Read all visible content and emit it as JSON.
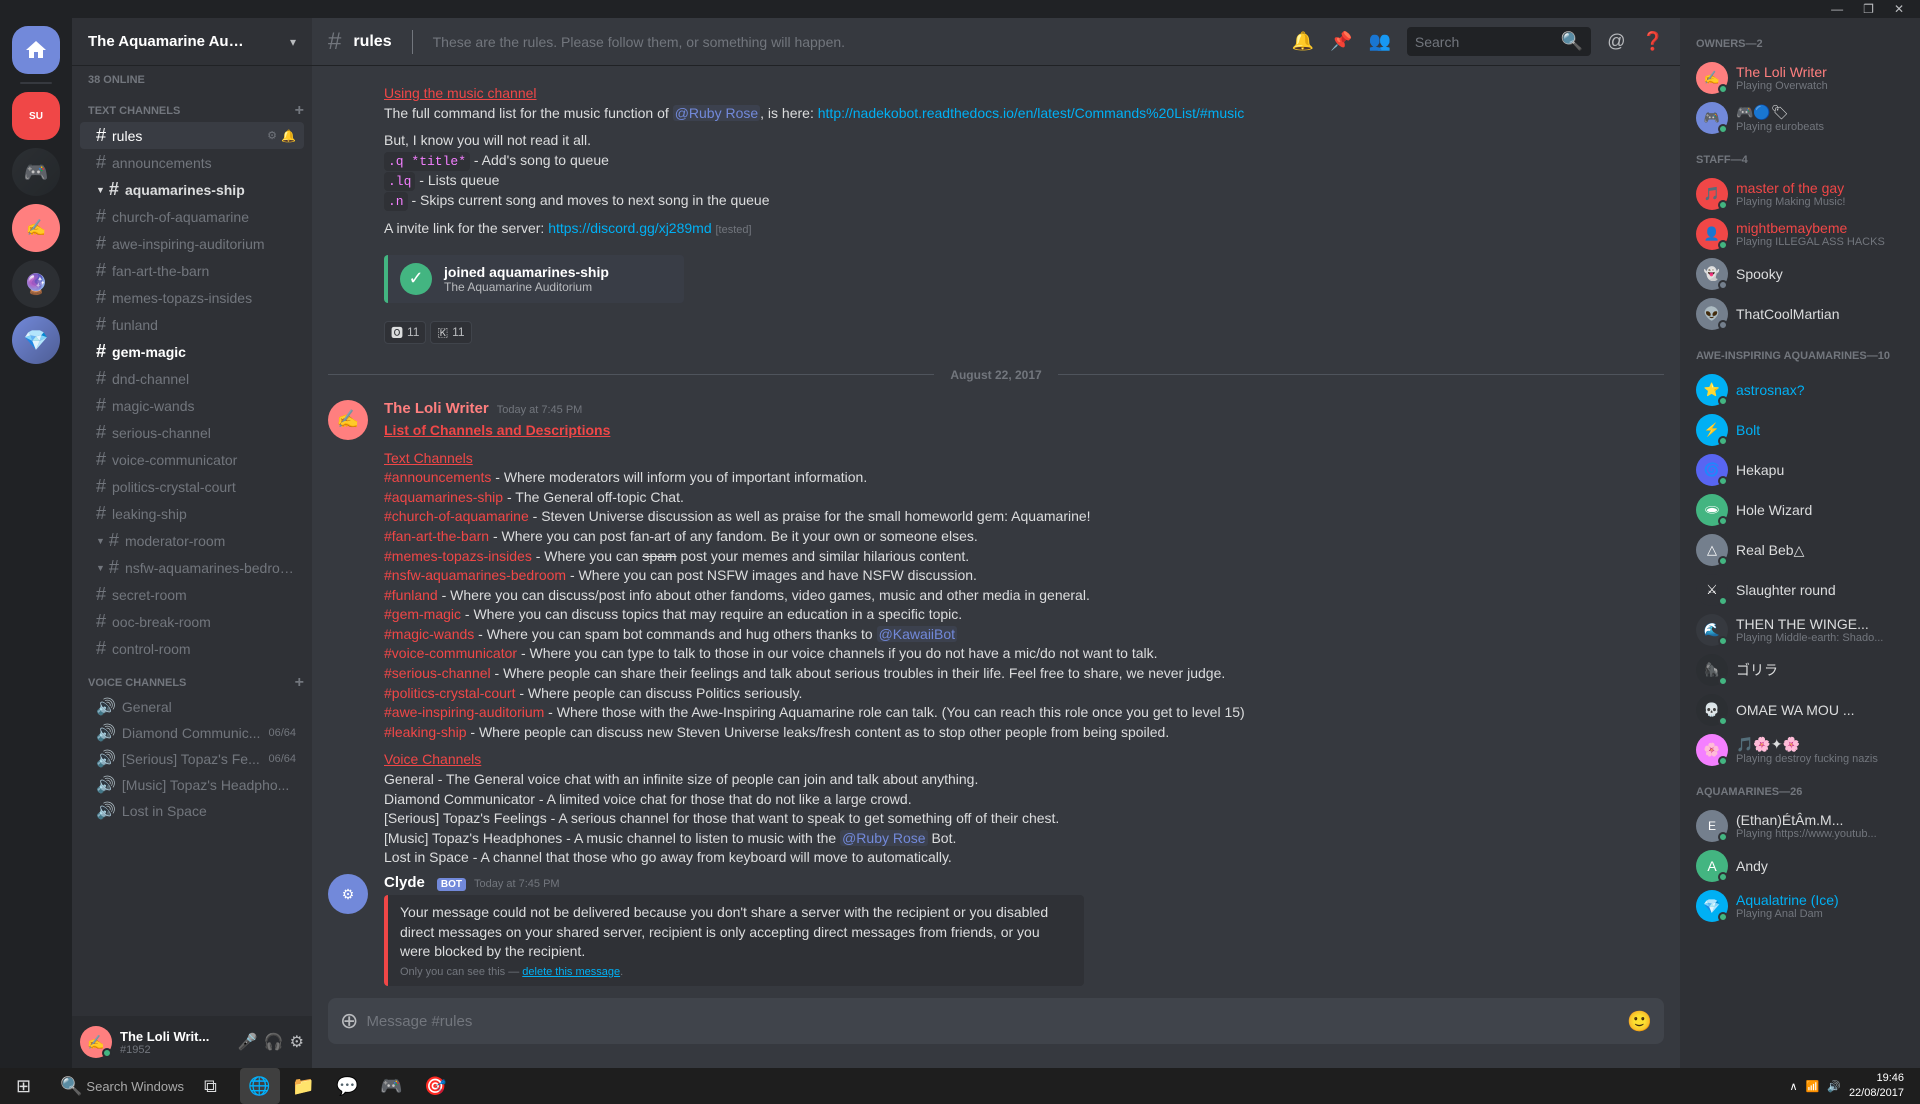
{
  "topbar": {
    "buttons": [
      "—",
      "❐",
      "✕"
    ]
  },
  "server": {
    "name": "The Aquamarine Auditori...",
    "online_count": "38 ONLINE"
  },
  "channel_header": {
    "name": "rules",
    "topic": "These are the rules. Please follow them, or something will happen.",
    "search_placeholder": "Search"
  },
  "sidebar": {
    "text_section_label": "TEXT CHANNELS",
    "voice_section_label": "VOICE CHANNELS",
    "text_channels": [
      {
        "name": "rules",
        "active": true,
        "unread": false
      },
      {
        "name": "announcements",
        "active": false,
        "unread": false
      },
      {
        "name": "aquamarines-ship",
        "active": false,
        "unread": true,
        "expandable": true
      },
      {
        "name": "church-of-aquamarine",
        "active": false,
        "unread": false
      },
      {
        "name": "awe-inspiring-auditorium",
        "active": false,
        "unread": false
      },
      {
        "name": "fan-art-the-barn",
        "active": false,
        "unread": false
      },
      {
        "name": "memes-topazs-insides",
        "active": false,
        "unread": false
      },
      {
        "name": "funland",
        "active": false,
        "unread": false
      },
      {
        "name": "gem-magic",
        "active": false,
        "unread": false,
        "bold": true
      },
      {
        "name": "dnd-channel",
        "active": false,
        "unread": false
      },
      {
        "name": "magic-wands",
        "active": false,
        "unread": false
      },
      {
        "name": "serious-channel",
        "active": false,
        "unread": false
      },
      {
        "name": "voice-communicator",
        "active": false,
        "unread": false
      },
      {
        "name": "politics-crystal-court",
        "active": false,
        "unread": false
      },
      {
        "name": "leaking-ship",
        "active": false,
        "unread": false
      },
      {
        "name": "moderator-room",
        "active": false,
        "unread": false,
        "expandable": true
      },
      {
        "name": "nsfw-aquamarines-bedroo...",
        "active": false,
        "unread": false,
        "expandable": true
      },
      {
        "name": "secret-room",
        "active": false,
        "unread": false
      },
      {
        "name": "ooc-break-room",
        "active": false,
        "unread": false
      },
      {
        "name": "control-room",
        "active": false,
        "unread": false
      }
    ],
    "voice_channels": [
      {
        "name": "General"
      },
      {
        "name": "Diamond Communic...",
        "count": "06/64"
      },
      {
        "name": "[Serious] Topaz's Fe...",
        "count": "06/64"
      },
      {
        "name": "[Music] Topaz's Headpho...",
        "count": ""
      },
      {
        "name": "Lost in Space",
        "count": ""
      }
    ]
  },
  "user_area": {
    "name": "The Loli Writ...",
    "discriminator": "#1952",
    "avatar_emoji": "✍"
  },
  "messages": [
    {
      "id": "msg1",
      "type": "system_top",
      "content_lines": [
        "Using the music channel",
        "The full command list for the music function of @Ruby Rose, is here: http://nadekobot.readthedocs.io/en/latest/Commands%20List/#music",
        "",
        "But, I know you will not read it all.",
        ".q *title* - Add's song to queue",
        ".lq - Lists queue",
        ".n - Skips current song and moves to next song in the queue",
        "",
        "A invite link for the server: https://discord.gg/xj289md [tested]"
      ]
    },
    {
      "id": "msg_reactions",
      "reactions": [
        {
          "emoji": "🅾",
          "count": "11"
        },
        {
          "emoji": "🇰",
          "count": "11"
        }
      ]
    },
    {
      "id": "date_divider",
      "date": "August 22, 2017"
    },
    {
      "id": "msg2",
      "author": "The Loli Writer",
      "author_color": "#ff7f7f",
      "timestamp": "Today at 7:45 PM",
      "content_title": "List of Channels and Descriptions",
      "content": [
        "Text Channels",
        "#announcements - Where moderators will inform you of important information.",
        "#aquamarines-ship - The General off-topic Chat.",
        "#church-of-aquamarine - Steven Universe discussion as well as praise for the small homeworld gem: Aquamarine!",
        "#fan-art-the-barn - Where you can post fan-art of any fandom. Be it your own or someone elses.",
        "#memes-topazs-insides - Where you can spam post your memes and similar hilarious content.",
        "#nsfw-aquamarines-bedroom - Where you can post NSFW images and have NSFW discussion.",
        "#funland - Where you can discuss/post info about other fandoms, video games, music and other media in general.",
        "#gem-magic - Where you can discuss topics that may require an education in a specific topic.",
        "#magic-wands - Where you can spam bot commands and hug others thanks to @KawaiiBot",
        "#voice-communicator - Where you can type to talk to those in our voice channels if you do not have a mic/do not want to talk.",
        "#serious-channel - Where people can share their feelings and talk about serious troubles in their life. Feel free to share, we never judge.",
        "#politics-crystal-court - Where people can discuss Politics seriously.",
        "#awe-inspiring-auditorium - Where those with the Awe-Inspiring Aquamarine role can talk. (You can reach this role once you get to level 15)",
        "#leaking-ship - Where people can discuss new Steven Universe leaks/fresh content as to stop other people from being spoiled.",
        "",
        "Voice Channels",
        "General - The General voice chat with an infinite size of people can join and talk about anything.",
        "Diamond Communicator - A limited voice chat for those that do not like a large crowd.",
        "[Serious] Topaz's Feelings - A serious channel for those that want to speak to get something off of their chest.",
        "[Music] Topaz's Headphones - A music channel to listen to music with the @Ruby Rose Bot.",
        "Lost in Space - A channel that those who go away from keyboard will move to automatically."
      ]
    },
    {
      "id": "msg3",
      "author": "Clyde",
      "author_color": "#7289da",
      "is_bot": true,
      "timestamp": "Today at 7:45 PM",
      "content": "Your message could not be delivered because you don't share a server with the recipient or you disabled direct messages on your shared server, recipient is only accepting direct messages from friends, or you were blocked by the recipient.",
      "only_you": "Only you can see this — delete this message."
    }
  ],
  "message_input": {
    "placeholder": "Message #rules"
  },
  "members": {
    "owners": {
      "label": "OWNERS—2",
      "items": [
        {
          "name": "The Loli Writer",
          "color": "#ff7f7f",
          "activity": "Playing Overwatch",
          "status": "online",
          "emoji": "✍"
        },
        {
          "name": "🎮🔵🏷",
          "color": "#dcddde",
          "activity": "Playing eurobeats",
          "status": "online",
          "emoji": "🎮"
        }
      ]
    },
    "staff": {
      "label": "STAFF—4",
      "items": [
        {
          "name": "master of the gay",
          "color": "#f04747",
          "activity": "Playing Making Music!",
          "status": "online",
          "emoji": "🎵"
        },
        {
          "name": "mightbemaybeme",
          "color": "#f04747",
          "activity": "Playing ILLEGAL ASS HACKS",
          "status": "online",
          "emoji": "👤"
        },
        {
          "name": "Spooky",
          "color": "#dcddde",
          "activity": "",
          "status": "offline",
          "emoji": "👻"
        },
        {
          "name": "ThatCoolMartian",
          "color": "#dcddde",
          "activity": "",
          "status": "offline",
          "emoji": "👽"
        }
      ]
    },
    "awe_inspiring": {
      "label": "AWE-INSPIRING AQUAMARINES—10",
      "items": [
        {
          "name": "astrosnax?",
          "color": "#00b0f4",
          "activity": "",
          "status": "online",
          "emoji": "⭐"
        },
        {
          "name": "Bolt",
          "color": "#00b0f4",
          "activity": "",
          "status": "online",
          "emoji": "⚡"
        },
        {
          "name": "Hekapu",
          "color": "#dcddde",
          "activity": "",
          "status": "online",
          "emoji": "🌀"
        },
        {
          "name": "Hole Wizard",
          "color": "#dcddde",
          "activity": "",
          "status": "online",
          "emoji": "🕳"
        },
        {
          "name": "Real Beb△",
          "color": "#dcddde",
          "activity": "",
          "status": "online",
          "emoji": "△"
        },
        {
          "name": "Slaughter round",
          "color": "#dcddde",
          "activity": "",
          "status": "online",
          "emoji": "⚔"
        },
        {
          "name": "THEN THE WINGE...",
          "color": "#dcddde",
          "activity": "Playing Middle-earth: Shado...",
          "status": "online",
          "emoji": "🌊"
        },
        {
          "name": "ゴリラ",
          "color": "#dcddde",
          "activity": "",
          "status": "online",
          "emoji": "🦍"
        },
        {
          "name": "OMAE WA MOU ...",
          "color": "#dcddde",
          "activity": "",
          "status": "online",
          "emoji": "💀"
        },
        {
          "name": "🎵🌸✦🌸",
          "color": "#dcddde",
          "activity": "Playing destroy fucking nazis",
          "status": "online",
          "emoji": "🌸"
        }
      ]
    },
    "aquamarines": {
      "label": "AQUAMARINES—26",
      "items": [
        {
          "name": "(Ethan)ÉtÂm.M...",
          "color": "#dcddde",
          "activity": "Playing https://www.youtub...",
          "status": "online",
          "emoji": "E"
        },
        {
          "name": "Andy",
          "color": "#dcddde",
          "activity": "",
          "status": "online",
          "emoji": "A"
        },
        {
          "name": "Aqualatrine (Ice)",
          "color": "#00b0f4",
          "activity": "Playing Anal Dam",
          "status": "online",
          "emoji": "💎"
        }
      ]
    }
  },
  "taskbar": {
    "time": "19:46",
    "date": "22/08/2017",
    "start_icon": "⊞"
  }
}
